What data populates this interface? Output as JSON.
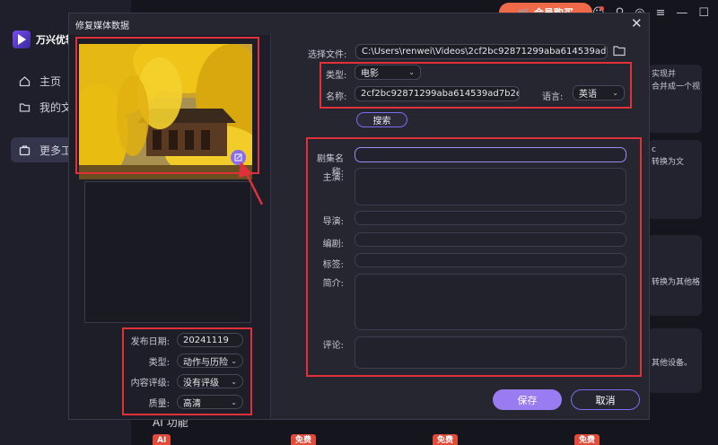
{
  "app": {
    "logo_text": "万兴优转",
    "nav": [
      {
        "label": "主页",
        "icon": "home-icon"
      },
      {
        "label": "我的文件",
        "icon": "folder-icon"
      },
      {
        "label": "更多工具",
        "icon": "toolbox-icon"
      }
    ],
    "topbar_button": "会员购买",
    "cards": [
      {
        "text": "实现并\n合并成一个视"
      },
      {
        "text": "c\n转换为文"
      },
      {
        "text": "\n\n\n转换为其他格"
      },
      {
        "text": "\n\n其他设备。"
      }
    ],
    "section_label": "AI 功能",
    "badges": [
      "AI",
      "免费",
      "免费",
      "免费"
    ]
  },
  "dialog": {
    "title": "修复媒体数据",
    "close_icon": "close-icon",
    "left": {
      "release_date_label": "发布日期:",
      "release_date_value": "20241119",
      "genre_label": "类型:",
      "genre_value": "动作与历险",
      "rating_label": "内容评级:",
      "rating_value": "没有评级",
      "quality_label": "质量:",
      "quality_value": "高清"
    },
    "right": {
      "file_label": "选择文件:",
      "file_value": "C:\\Users\\renwei\\Videos\\2cf2bc92871299aba614539ad7b2e717_",
      "type_label": "类型:",
      "type_value": "电影",
      "name_label": "名称:",
      "name_value": "2cf2bc92871299aba614539ad7b2e717_1",
      "language_label": "语言:",
      "language_value": "英语",
      "search_button": "搜索",
      "episode_name_label": "剧集名称:",
      "cast_label": "主演:",
      "director_label": "导演:",
      "writer_label": "编剧:",
      "tags_label": "标签:",
      "summary_label": "简介:",
      "comment_label": "评论:"
    },
    "save_button": "保存",
    "cancel_button": "取消"
  },
  "colors": {
    "accent": "#9a7cf2",
    "annotation": "#e0303a",
    "promo": "#f06a4a"
  }
}
